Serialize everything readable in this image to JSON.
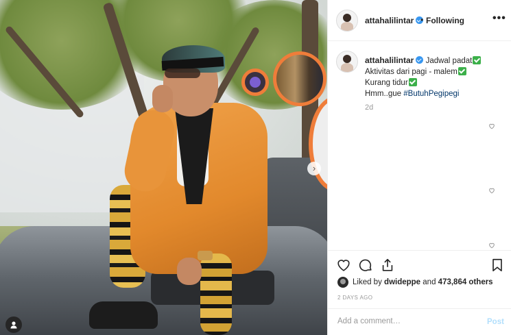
{
  "post": {
    "username": "attahalilintar",
    "follow_status": "Following",
    "separator": "•",
    "more_label": "•••",
    "caption": {
      "line1": "Jadwal padat",
      "line2": "Aktivitas dari pagi - malem",
      "line3": "Kurang tidur",
      "line4_prefix": "Hmm..gue ",
      "hashtag": "#ButuhPegipegi"
    },
    "time_ago": "2d",
    "liked_by_prefix": "Liked by ",
    "liked_by_user": "dwideppe",
    "liked_by_and": " and ",
    "others": "473,864 others",
    "date": "2 DAYS AGO",
    "comment_placeholder": "Add a comment…",
    "post_button": "Post",
    "carousel_next": "›"
  },
  "colors": {
    "accent": "#3897f0",
    "check": "#3cb04a",
    "hashtag": "#003569",
    "bubble_ring": "#ef7d3a"
  },
  "icons": [
    "heart-icon",
    "comment-icon",
    "share-icon",
    "bookmark-icon",
    "more-options-icon",
    "verified-icon",
    "user-tag-icon",
    "chevron-right-icon"
  ]
}
